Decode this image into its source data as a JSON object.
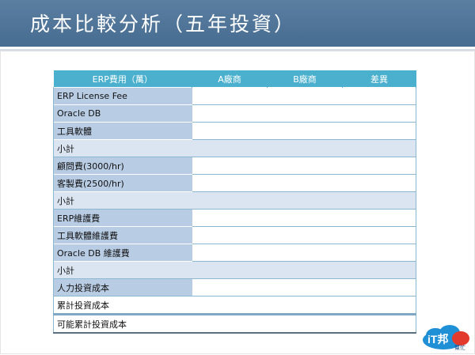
{
  "slide": {
    "title": "成本比較分析（五年投資）"
  },
  "table": {
    "headers": [
      "ERP費用（萬）",
      "A廠商",
      "B廠商",
      "差異"
    ],
    "rows": [
      {
        "label": "ERP License Fee",
        "kind": "item"
      },
      {
        "label": "Oracle DB",
        "kind": "item"
      },
      {
        "label": "工具軟體",
        "kind": "item"
      },
      {
        "label": "小計",
        "kind": "subtotal"
      },
      {
        "label": "顧問費(3000/hr)",
        "kind": "item"
      },
      {
        "label": "客製費(2500/hr)",
        "kind": "item"
      },
      {
        "label": "小計",
        "kind": "subtotal"
      },
      {
        "label": "ERP維護費",
        "kind": "item"
      },
      {
        "label": "工具軟體維護費",
        "kind": "item"
      },
      {
        "label": "Oracle DB 維護費",
        "kind": "item"
      },
      {
        "label": "小計",
        "kind": "subtotal"
      },
      {
        "label": "人力投資成本",
        "kind": "item"
      },
      {
        "label": "累計投資成本",
        "kind": "total"
      },
      {
        "label": "可能累計投資成本",
        "kind": "grand-total"
      }
    ]
  },
  "logo": {
    "text": "iT邦",
    "subtext": "幫忙",
    "colors": {
      "blue": "#1f8fd6",
      "red": "#e23b2e",
      "dark": "#1a4f8a"
    }
  }
}
